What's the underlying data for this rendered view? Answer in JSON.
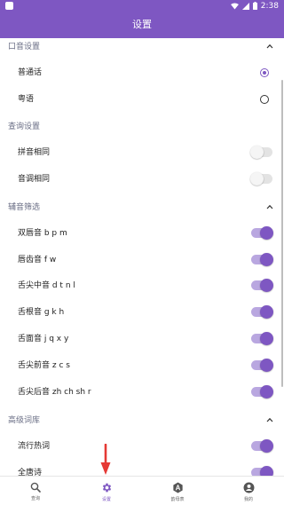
{
  "status_bar": {
    "time": "2:38"
  },
  "app_bar": {
    "title": "设置"
  },
  "sections": [
    {
      "title": "口音设置",
      "kind": "radio",
      "rows": [
        {
          "label": "普通话",
          "checked": true
        },
        {
          "label": "粤语",
          "checked": false
        }
      ]
    },
    {
      "title": "查询设置",
      "kind": "switch",
      "rows": [
        {
          "label": "拼音相同",
          "on": false
        },
        {
          "label": "音调相同",
          "on": false
        }
      ]
    },
    {
      "title": "辅音筛选",
      "kind": "switch",
      "rows": [
        {
          "label": "双唇音 b p m",
          "on": true
        },
        {
          "label": "唇齿音 f w",
          "on": true
        },
        {
          "label": "舌尖中音 d t n l",
          "on": true
        },
        {
          "label": "舌根音 g k h",
          "on": true
        },
        {
          "label": "舌面音 j q x y",
          "on": true
        },
        {
          "label": "舌尖前音 z c s",
          "on": true
        },
        {
          "label": "舌尖后音 zh ch sh r",
          "on": true
        }
      ]
    },
    {
      "title": "高级词库",
      "kind": "switch",
      "rows": [
        {
          "label": "流行热词",
          "on": true
        },
        {
          "label": "全唐诗",
          "on": true
        }
      ]
    }
  ],
  "bottom_nav": {
    "tabs": [
      {
        "label": "查询",
        "icon": "search-icon",
        "active": false
      },
      {
        "label": "设置",
        "icon": "gear-icon",
        "active": true
      },
      {
        "label": "韵母表",
        "icon": "alphabet-icon",
        "active": false
      },
      {
        "label": "我的",
        "icon": "account-icon",
        "active": false
      }
    ]
  },
  "colors": {
    "primary": "#7e57c2",
    "switch_track_on": "#b9a7e0",
    "section_title": "#6a6e85",
    "annotation_arrow": "#e53935"
  }
}
